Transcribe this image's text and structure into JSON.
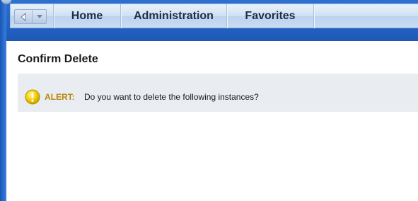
{
  "navbar": {
    "items": [
      {
        "label": "Home"
      },
      {
        "label": "Administration"
      },
      {
        "label": "Favorites"
      }
    ]
  },
  "page": {
    "title": "Confirm Delete"
  },
  "alert": {
    "label": "ALERT:",
    "message": "Do you want to delete the following instances?"
  }
}
